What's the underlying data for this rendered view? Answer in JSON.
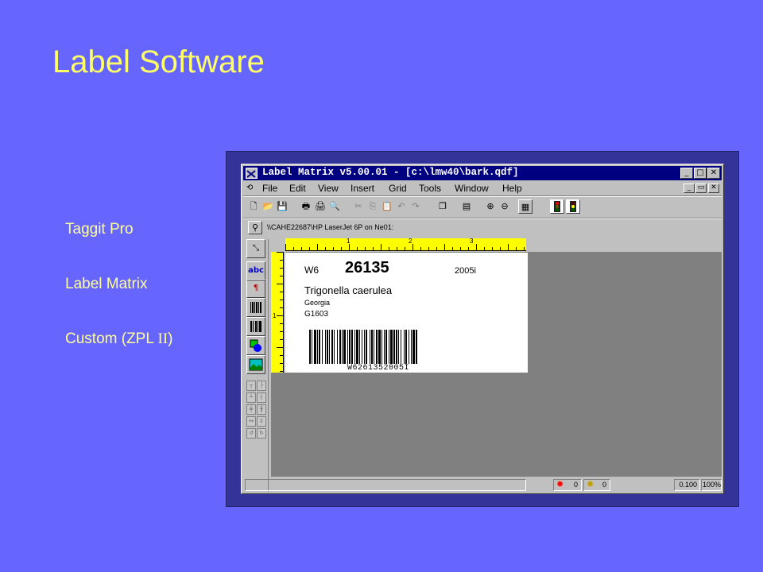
{
  "slide": {
    "title": "Label Software",
    "bullets": [
      "Taggit Pro",
      "Label Matrix"
    ],
    "bullet3_prefix": "Custom (ZPL ",
    "bullet3_roman": "II",
    "bullet3_suffix": ")"
  },
  "app": {
    "title": "Label Matrix v5.00.01 - [c:\\lmw40\\bark.qdf]",
    "window_buttons": {
      "minimize": "_",
      "maximize": "□",
      "close": "✕"
    },
    "menu": [
      "File",
      "Edit",
      "View",
      "Insert",
      "Grid",
      "Tools",
      "Window",
      "Help"
    ],
    "mdi_buttons": {
      "minimize": "_",
      "restore": "▭",
      "close": "✕"
    },
    "printer_path": "\\\\CAHE22687\\HP LaserJet 6P on Ne01:",
    "ruler_top_marks": [
      "1",
      "2",
      "3"
    ],
    "ruler_left_marks": [
      "1"
    ],
    "tools": {
      "text_tool": "abc"
    },
    "label": {
      "code": "W6",
      "number": "26135",
      "id": "2005i",
      "species": "Trigonella caerulea",
      "location": "Georgia",
      "accession": "G1603",
      "barcode_text": "W6261352005I"
    },
    "status": {
      "error_count": "0",
      "warning_count": "0",
      "coords": "0.100",
      "zoom": "100%"
    }
  },
  "colors": {
    "slide_background": "#6666ff",
    "title_color": "#ffff66",
    "bullet_color": "#ffff99",
    "titlebar": "#000080",
    "ruler": "#ffff00",
    "workspace": "#808080"
  }
}
